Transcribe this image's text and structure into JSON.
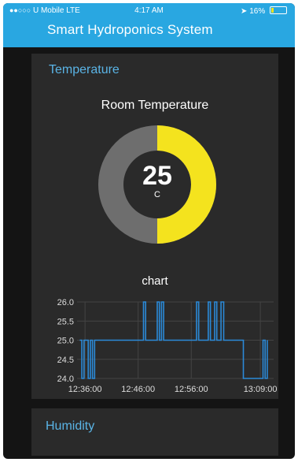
{
  "status_bar": {
    "carrier": "U Mobile",
    "network": "LTE",
    "time": "4:17 AM",
    "battery": "16%",
    "battery_level": 0.16
  },
  "app": {
    "title": "Smart Hydroponics System"
  },
  "temperature_card": {
    "title": "Temperature",
    "gauge": {
      "label": "Room Temperature",
      "value": "25",
      "unit": "C",
      "fill_fraction": 0.5
    },
    "chart_title": "chart"
  },
  "humidity_card": {
    "title": "Humidity"
  },
  "colors": {
    "header": "#29a7e1",
    "card": "#2a2a2a",
    "accent_text": "#5ab4e6",
    "gauge_fill": "#f4e31e",
    "gauge_track": "#6e6e6e",
    "series": "#2b8ad8"
  },
  "chart_data": {
    "type": "line",
    "title": "chart",
    "x_ticks": [
      "12:36:00",
      "12:46:00",
      "12:56:00",
      "13:09:00"
    ],
    "x_tick_minutes": [
      0,
      10,
      20,
      33
    ],
    "y_ticks": [
      "26.0",
      "25.5",
      "25.0",
      "24.5",
      "24.0"
    ],
    "ylim": [
      24.0,
      26.0
    ],
    "xlim_minutes": [
      -1.5,
      35.5
    ],
    "grid": true,
    "series": [
      {
        "x_minutes": [
          -1,
          -0.6,
          -0.6,
          -0.2,
          -0.2,
          0.6,
          0.6,
          1.0,
          1.0,
          1.4,
          1.4,
          1.8,
          1.8,
          2.2,
          2.2,
          11,
          11,
          11.4,
          11.4,
          13.6,
          13.6,
          14,
          14,
          14.4,
          14.4,
          14.8,
          14.8,
          21,
          21,
          21.4,
          21.4,
          23.2,
          23.2,
          23.6,
          23.6,
          24.4,
          24.4,
          24.8,
          24.8,
          25.6,
          25.6,
          26.1,
          26.1,
          29.8,
          29.8,
          30.2,
          30.2,
          33.5,
          33.5,
          33.9,
          33.9,
          34.3,
          34.3
        ],
        "y": [
          25.0,
          25.0,
          24.0,
          24.0,
          25.0,
          25.0,
          24.0,
          24.0,
          25.0,
          25.0,
          24.0,
          24.0,
          25.0,
          25.0,
          25.0,
          25.0,
          26.0,
          26.0,
          25.0,
          25.0,
          26.0,
          26.0,
          25.0,
          25.0,
          26.0,
          26.0,
          25.0,
          25.0,
          26.0,
          26.0,
          25.0,
          25.0,
          26.0,
          26.0,
          25.0,
          25.0,
          26.0,
          26.0,
          25.0,
          25.0,
          26.0,
          26.0,
          25.0,
          25.0,
          24.0,
          24.0,
          24.0,
          24.0,
          25.0,
          25.0,
          24.0,
          24.0,
          25.0
        ]
      }
    ]
  }
}
